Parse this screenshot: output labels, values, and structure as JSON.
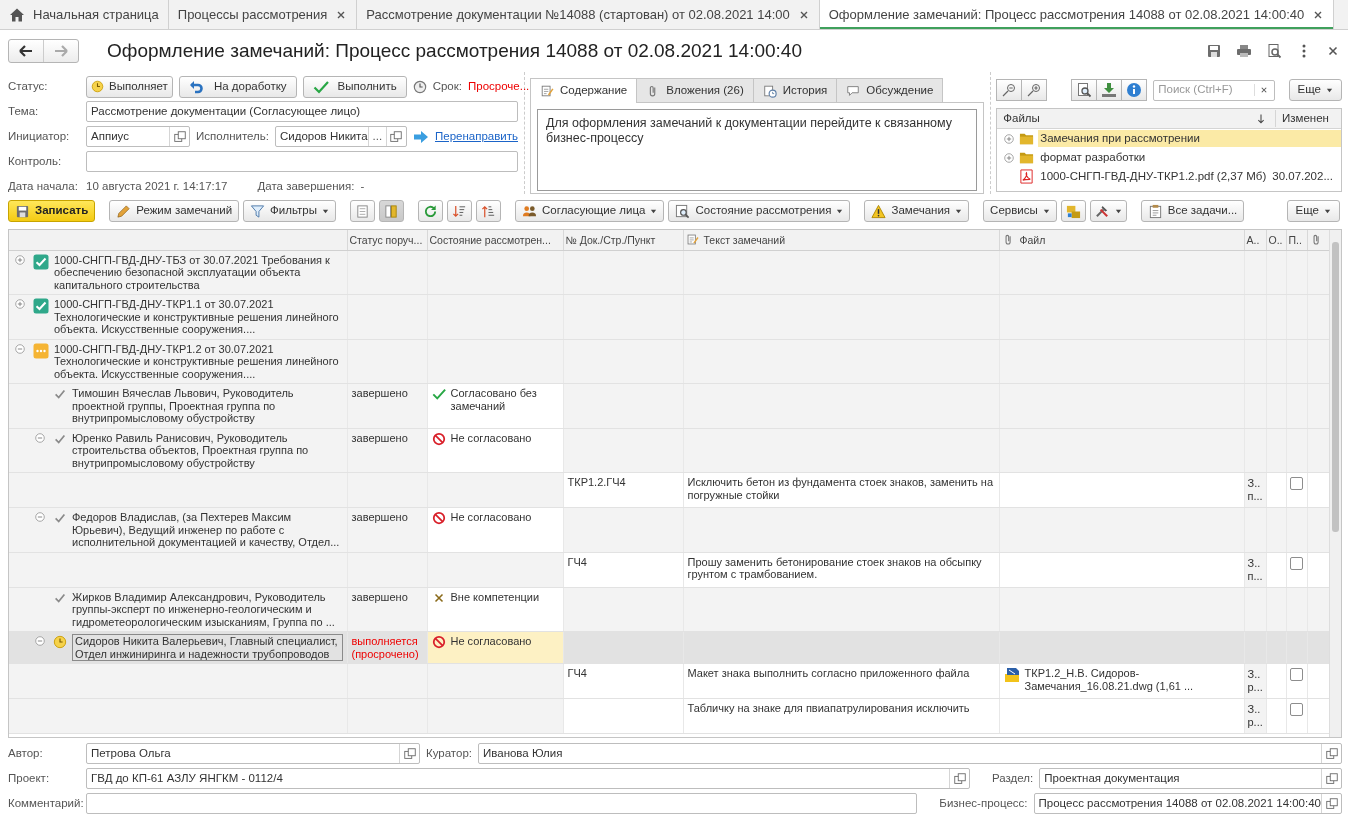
{
  "tabs": [
    {
      "label": "Начальная страница",
      "kind": "home",
      "selected": false
    },
    {
      "label": "Процессы рассмотрения",
      "kind": "closable",
      "selected": false
    },
    {
      "label": "Рассмотрение документации №14088 (стартован) от 02.08.2021 14:00",
      "kind": "closable",
      "selected": false
    },
    {
      "label": "Оформление замечаний: Процесс рассмотрения 14088 от 02.08.2021 14:00:40",
      "kind": "closable",
      "selected": true
    }
  ],
  "title": "Оформление замечаний: Процесс рассмотрения 14088 от 02.08.2021 14:00:40",
  "form": {
    "status": {
      "label": "Статус:",
      "value": "Выполняет"
    },
    "actions": [
      {
        "kind": "return",
        "label": "На доработку"
      },
      {
        "kind": "complete",
        "label": "Выполнить"
      }
    ],
    "deadline": {
      "label": "Срок:",
      "value": "Просроче...",
      "overdue": true
    },
    "subject": {
      "label": "Тема:",
      "value": "Рассмотрение документации (Согласующее лицо)"
    },
    "initiator": {
      "label": "Инициатор:",
      "value": "Аппиус"
    },
    "executor": {
      "label": "Исполнитель:",
      "value": "Сидоров Никита",
      "choice": "..."
    },
    "redirect_link": "Перенаправить",
    "control": {
      "label": "Контроль:"
    },
    "start_date": {
      "label": "Дата начала:",
      "value": "10 августа 2021 г. 14:17:17"
    },
    "end_date": {
      "label": "Дата завершения:",
      "value": "-"
    }
  },
  "content_tabs": [
    {
      "label": "Содержание",
      "kind": "note",
      "selected": true
    },
    {
      "label": "Вложения (26)",
      "kind": "clip",
      "selected": false
    },
    {
      "label": "История",
      "kind": "history",
      "selected": false
    },
    {
      "label": "Обсуждение",
      "kind": "speech",
      "selected": false
    }
  ],
  "content_text": "Для оформления замечаний к документации перейдите к связанному бизнес-процессу",
  "files": {
    "search": {
      "placeholder": "Поиск (Ctrl+F)"
    },
    "more": "Еще",
    "columns": [
      "Файлы",
      "Изменен"
    ],
    "rows": [
      {
        "kind": "folder",
        "name": "Замечания при рассмотрении",
        "selected": true
      },
      {
        "kind": "folder",
        "name": "формат разработки",
        "selected": false
      },
      {
        "kind": "pdf",
        "name": "1000-СНГП-ГВД-ДНУ-ТКР1.2.pdf (2,37 Мб)",
        "modified": "30.07.202...",
        "selected": false
      }
    ]
  },
  "toolbar": [
    {
      "kind": "save",
      "label": "Записать"
    },
    {
      "kind": "pencil",
      "label": "Режим замечаний"
    },
    {
      "kind": "filter",
      "label": "Фильтры",
      "dropdown": true
    },
    {
      "kind": "view-list",
      "pressed": false
    },
    {
      "kind": "view-split",
      "pressed": true
    },
    {
      "kind": "refresh"
    },
    {
      "kind": "sort-desc"
    },
    {
      "kind": "sort-asc"
    },
    {
      "kind": "people",
      "label": "Согласующие лица",
      "dropdown": true
    },
    {
      "kind": "magnifier",
      "label": "Состояние рассмотрения",
      "dropdown": true
    },
    {
      "kind": "warning",
      "label": "Замечания",
      "dropdown": true
    },
    {
      "kind": "plain",
      "label": "Сервисы",
      "dropdown": true
    },
    {
      "kind": "folders"
    },
    {
      "kind": "tools",
      "dropdown": true
    },
    {
      "kind": "tasks",
      "label": "Все задачи..."
    }
  ],
  "toolbar_more": "Еще",
  "table": {
    "columns": [
      {
        "kind": "tree"
      },
      {
        "label": "Статус поруч..."
      },
      {
        "label": "Состояние рассмотрен..."
      },
      {
        "label": "№ Док./Стр./Пункт"
      },
      {
        "label": "Текст замечаний",
        "kind": "note"
      },
      {
        "label": "Файл",
        "kind": "clip"
      },
      {
        "label": "А.."
      },
      {
        "label": "О.."
      },
      {
        "label": "П.."
      },
      {
        "kind": "clip"
      }
    ],
    "rows": [
      {
        "kind": "document",
        "approved": true,
        "expanded": false,
        "selected": false,
        "text": "1000-СНГП-ГВД-ДНУ-ТБЗ от 30.07.2021 Требования к обеспечению безопасной эксплуатации объекта капитального строительства"
      },
      {
        "kind": "document",
        "approved": true,
        "expanded": false,
        "selected": false,
        "text": "1000-СНГП-ГВД-ДНУ-ТКР1.1 от 30.07.2021 Технологические и конструктивные решения линейного объекта. Искусственные сооружения...."
      },
      {
        "kind": "document",
        "approved": false,
        "expanded": true,
        "selected": false,
        "text": "1000-СНГП-ГВД-ДНУ-ТКР1.2 от 30.07.2021 Технологические и конструктивные решения линейного объекта. Искусственные сооружения....",
        "children": [
          {
            "kind": "person",
            "completed": true,
            "selected": false,
            "name": "Тимошин Вячеслав Львович, Руководитель проектной группы, Проектная группа по внутрипромысловому обустройству",
            "status": "завершено",
            "overdue": false,
            "state": {
              "kind": "approved",
              "text": "Согласовано без замечаний"
            }
          },
          {
            "kind": "person",
            "completed": true,
            "selected": false,
            "expanded": true,
            "name": "Юренко Равиль Ранисович, Руководитель строительства объектов, Проектная группа по внутрипромысловому обустройству",
            "status": "завершено",
            "overdue": false,
            "state": {
              "kind": "rejected",
              "text": "Не согласовано"
            },
            "children": [
              {
                "kind": "remark",
                "selected": false,
                "doc": "ТКР1.2.ГЧ4",
                "text": "Исключить бетон из фундамента стоек знаков, заменить на погружные стойки",
                "col_a": "З.. п...",
                "checked": false
              }
            ]
          },
          {
            "kind": "person",
            "completed": true,
            "selected": false,
            "expanded": true,
            "name": "Федоров Владислав, (за Пехтерев Максим Юрьевич), Ведущий инженер по работе с исполнительной документацией и качеству, Отдел...",
            "status": "завершено",
            "overdue": false,
            "state": {
              "kind": "rejected",
              "text": "Не согласовано"
            },
            "children": [
              {
                "kind": "remark",
                "selected": false,
                "doc": "ГЧ4",
                "text": "Прошу заменить бетонирование стоек знаков на обсыпку грунтом с трамбованием.",
                "col_a": "З.. п...",
                "checked": false
              }
            ]
          },
          {
            "kind": "person",
            "completed": true,
            "selected": false,
            "name": "Жирков Владимир Александрович, Руководитель группы-эксперт по инженерно-геологическим и гидрометеорологическим изысканиям, Группа по ...",
            "status": "завершено",
            "overdue": false,
            "state": {
              "kind": "out_of_scope",
              "text": "Вне компетенции"
            }
          },
          {
            "kind": "person",
            "completed": false,
            "selected": true,
            "expanded": true,
            "name": "Сидоров Никита Валерьевич, Главный специалист, Отдел инжиниринга и надежности трубопроводов",
            "status": "выполняется (просрочено)",
            "overdue": true,
            "state": {
              "kind": "rejected",
              "text": "Не согласовано"
            },
            "children": [
              {
                "kind": "remark",
                "selected": false,
                "doc": "ГЧ4",
                "text": "Макет знака выполнить согласно приложенного файла",
                "file": "ТКР1.2_Н.В. Сидоров-Замечания_16.08.21.dwg (1,61 ...",
                "col_a": "З.. р...",
                "checked": false
              },
              {
                "kind": "remark",
                "selected": false,
                "text": "Табличку на знаке для пвиапатрулирования исключить",
                "col_a": "З.. р...",
                "checked": false
              }
            ]
          }
        ]
      }
    ]
  },
  "footer": {
    "author": {
      "label": "Автор:",
      "value": "Петрова Ольга"
    },
    "curator": {
      "label": "Куратор:",
      "value": "Иванова Юлия"
    },
    "project": {
      "label": "Проект:",
      "value": "ГВД до КП-61 АЗЛУ ЯНГКМ - 0112/4"
    },
    "section": {
      "label": "Раздел:",
      "value": "Проектная документация"
    },
    "comment": {
      "label": "Комментарий:"
    },
    "process": {
      "label": "Бизнес-процесс:",
      "value": "Процесс рассмотрения 14088 от 02.08.2021 14:00:40"
    }
  }
}
